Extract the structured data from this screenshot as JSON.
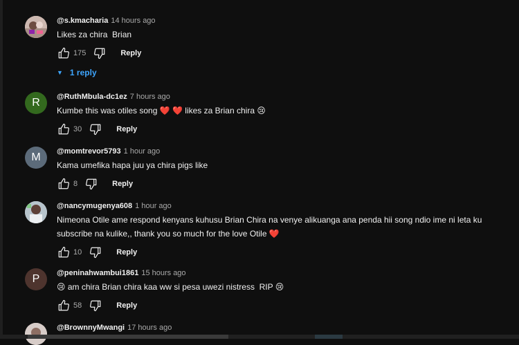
{
  "comments": [
    {
      "handle": "@s.kmacharia",
      "time": "14 hours ago",
      "text": "Likes za chira  Brian",
      "likes": "175",
      "reply_label": "Reply",
      "replies_label": "1 reply"
    },
    {
      "handle": "@RuthMbula-dc1ez",
      "time": "7 hours ago",
      "text": "Kumbe this was otiles song ❤️ ❤️ likes za Brian chira 😢",
      "likes": "30",
      "reply_label": "Reply",
      "avatar_letter": "R",
      "avatar_color": "#33691e"
    },
    {
      "handle": "@momtrevor5793",
      "time": "1 hour ago",
      "text": "Kama umefika hapa juu ya chira pigs like",
      "likes": "8",
      "reply_label": "Reply",
      "avatar_letter": "M",
      "avatar_color": "#5c6b7a"
    },
    {
      "handle": "@nancymugenya608",
      "time": "1 hour ago",
      "text": "Nimeona Otile ame respond kenyans kuhusu Brian Chira na venye alikuanga ana penda hii song ndio ime ni leta ku subscribe na kulike,, thank you so much for the love Otile ❤️",
      "likes": "10",
      "reply_label": "Reply"
    },
    {
      "handle": "@peninahwambui1861",
      "time": "15 hours ago",
      "text": "😢 am chira Brian chira kaa ww si pesa uwezi nistress  RIP 😢",
      "likes": "58",
      "reply_label": "Reply",
      "avatar_letter": "P",
      "avatar_color": "#4e342e"
    },
    {
      "handle": "@BrownnyMwangi",
      "time": "17 hours ago"
    }
  ],
  "icons": {
    "like": "thumb-up-icon",
    "dislike": "thumb-down-icon",
    "replies_caret": "caret-down-icon"
  },
  "colors": {
    "background": "#0f0f0f",
    "text": "#f1f1f1",
    "secondary_text": "#aaaaaa",
    "link_blue": "#3ea6ff"
  }
}
